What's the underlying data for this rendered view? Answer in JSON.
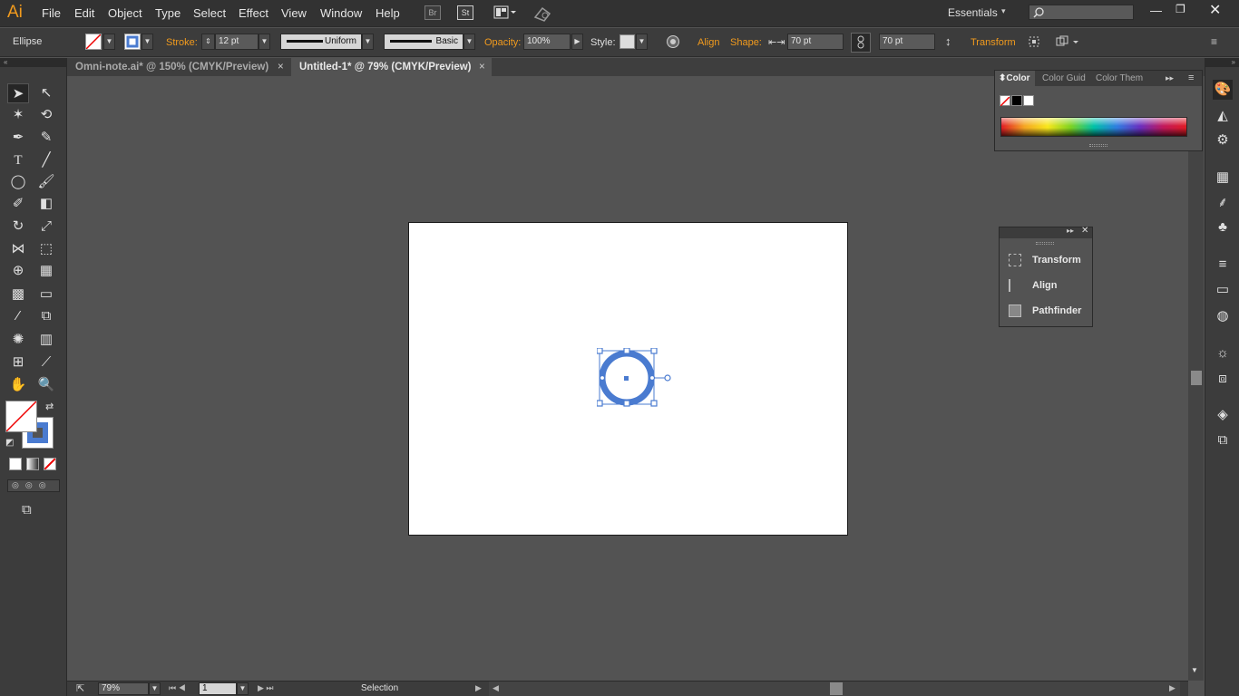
{
  "app": {
    "logo": "Ai",
    "workspace": "Essentials"
  },
  "menu": [
    "File",
    "Edit",
    "Object",
    "Type",
    "Select",
    "Effect",
    "View",
    "Window",
    "Help"
  ],
  "appbar_buttons": {
    "bridge": "Br",
    "stock": "St"
  },
  "control": {
    "tool_label": "Ellipse",
    "stroke_label": "Stroke:",
    "stroke_value": "12 pt",
    "profile_uniform": "Uniform",
    "brush_basic": "Basic",
    "opacity_label": "Opacity:",
    "opacity_value": "100%",
    "style_label": "Style:",
    "align_label": "Align",
    "shape_label": "Shape:",
    "width_value": "70 pt",
    "height_value": "70 pt",
    "transform_label": "Transform"
  },
  "tabs": [
    {
      "label": "Omni-note.ai* @ 150% (CMYK/Preview)",
      "active": false
    },
    {
      "label": "Untitled-1* @ 79% (CMYK/Preview)",
      "active": true
    }
  ],
  "color_panel": {
    "tabs": [
      "Color",
      "Color Guid",
      "Color Them"
    ]
  },
  "float_panel": {
    "items": [
      "Transform",
      "Align",
      "Pathfinder"
    ]
  },
  "status": {
    "zoom": "79%",
    "page": "1",
    "tool": "Selection"
  },
  "colors": {
    "accent": "#f29b1d",
    "selection": "#4a7bd0",
    "ui_bg": "#535353"
  }
}
